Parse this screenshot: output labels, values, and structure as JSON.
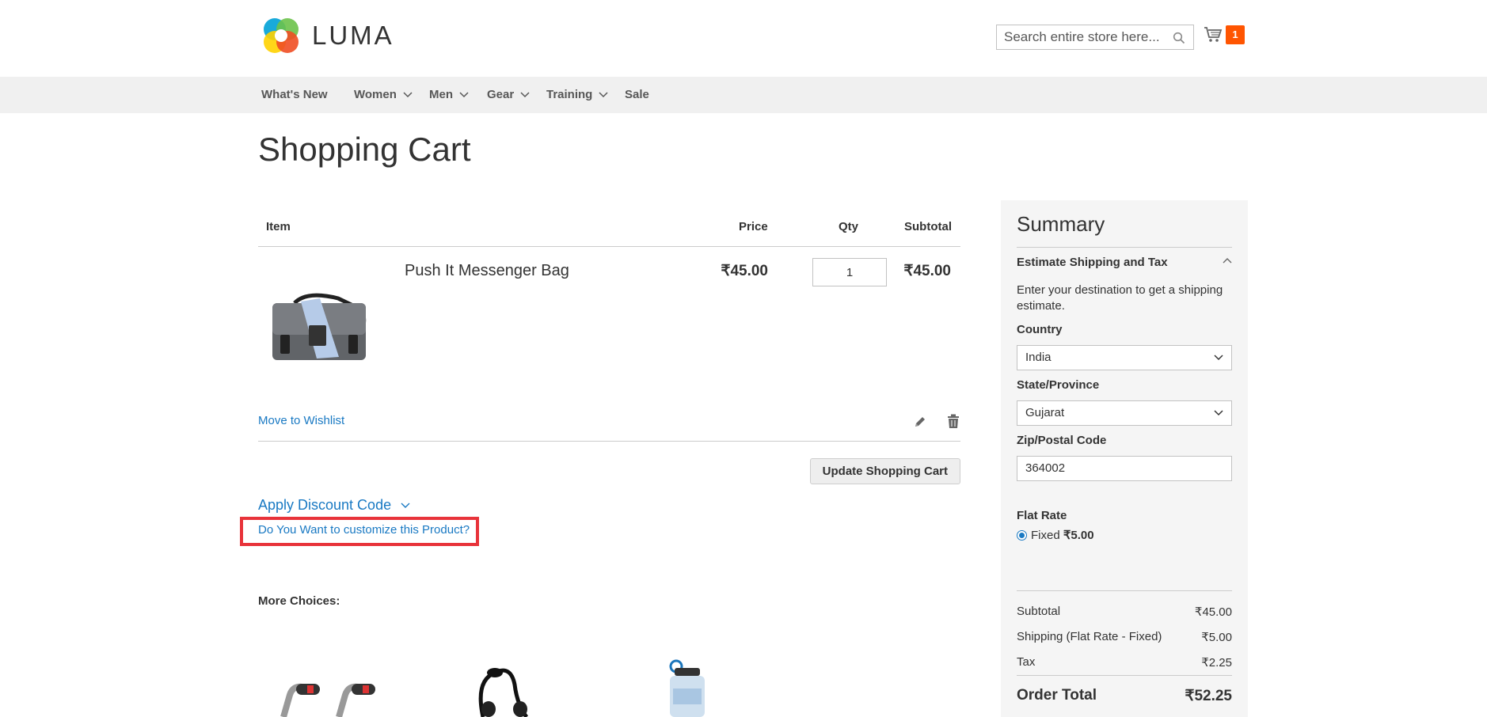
{
  "header": {
    "logo_text": "LUMA",
    "search_placeholder": "Search entire store here...",
    "cart_count": "1"
  },
  "nav": {
    "items": [
      {
        "label": "What's New",
        "has_dropdown": false
      },
      {
        "label": "Women",
        "has_dropdown": true
      },
      {
        "label": "Men",
        "has_dropdown": true
      },
      {
        "label": "Gear",
        "has_dropdown": true
      },
      {
        "label": "Training",
        "has_dropdown": true
      },
      {
        "label": "Sale",
        "has_dropdown": false
      }
    ]
  },
  "page_title": "Shopping Cart",
  "cart": {
    "headers": {
      "item": "Item",
      "price": "Price",
      "qty": "Qty",
      "subtotal": "Subtotal"
    },
    "item": {
      "name": "Push It Messenger Bag",
      "price": "₹45.00",
      "qty": "1",
      "subtotal": "₹45.00"
    },
    "move_to_wishlist": "Move to Wishlist",
    "update_button": "Update Shopping Cart"
  },
  "discount": {
    "label": "Apply Discount Code",
    "customize_link": "Do You Want to customize this Product?"
  },
  "more_choices": {
    "title": "More Choices:"
  },
  "summary": {
    "title": "Summary",
    "estimate_title": "Estimate Shipping and Tax",
    "estimate_desc": "Enter your destination to get a shipping estimate.",
    "country_label": "Country",
    "country_value": "India",
    "state_label": "State/Province",
    "state_value": "Gujarat",
    "zip_label": "Zip/Postal Code",
    "zip_value": "364002",
    "flat_rate_title": "Flat Rate",
    "flat_rate_option": "Fixed",
    "flat_rate_price": "₹5.00",
    "totals": {
      "subtotal_label": "Subtotal",
      "subtotal_value": "₹45.00",
      "shipping_label": "Shipping (Flat Rate - Fixed)",
      "shipping_value": "₹5.00",
      "tax_label": "Tax",
      "tax_value": "₹2.25",
      "order_total_label": "Order Total",
      "order_total_value": "₹52.25"
    }
  },
  "colors": {
    "link": "#1979c3",
    "badge": "#ff5501",
    "highlight": "#e8333a"
  }
}
